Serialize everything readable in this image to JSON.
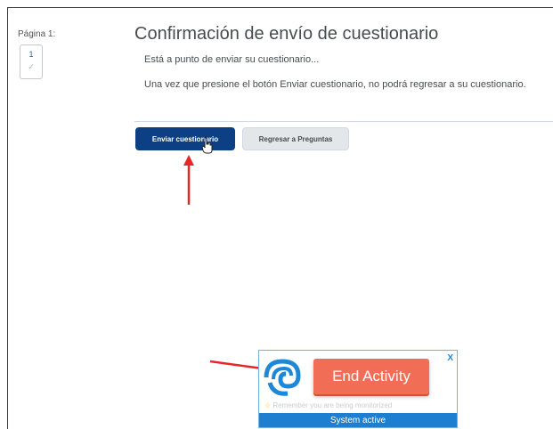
{
  "sidebar": {
    "page_label": "Página 1:",
    "page_number": "1"
  },
  "quiz": {
    "title": "Confirmación de envío de cuestionario",
    "intro": "Está a punto de enviar su cuestionario...",
    "warning": "Una vez que presione el botón Enviar cuestionario, no podrá regresar a su cuestionario.",
    "submit_label": "Enviar cuestionario",
    "back_label": "Regresar a Preguntas"
  },
  "widget": {
    "close_label": "X",
    "end_activity_label": "End Activity",
    "reminder": "Remember you are being monitorized",
    "status": "System active"
  },
  "colors": {
    "primary_button": "#0c3f84",
    "end_activity_button": "#f26d56",
    "status_bar": "#1e7fd0",
    "annotation_arrow": "#e8262a"
  }
}
